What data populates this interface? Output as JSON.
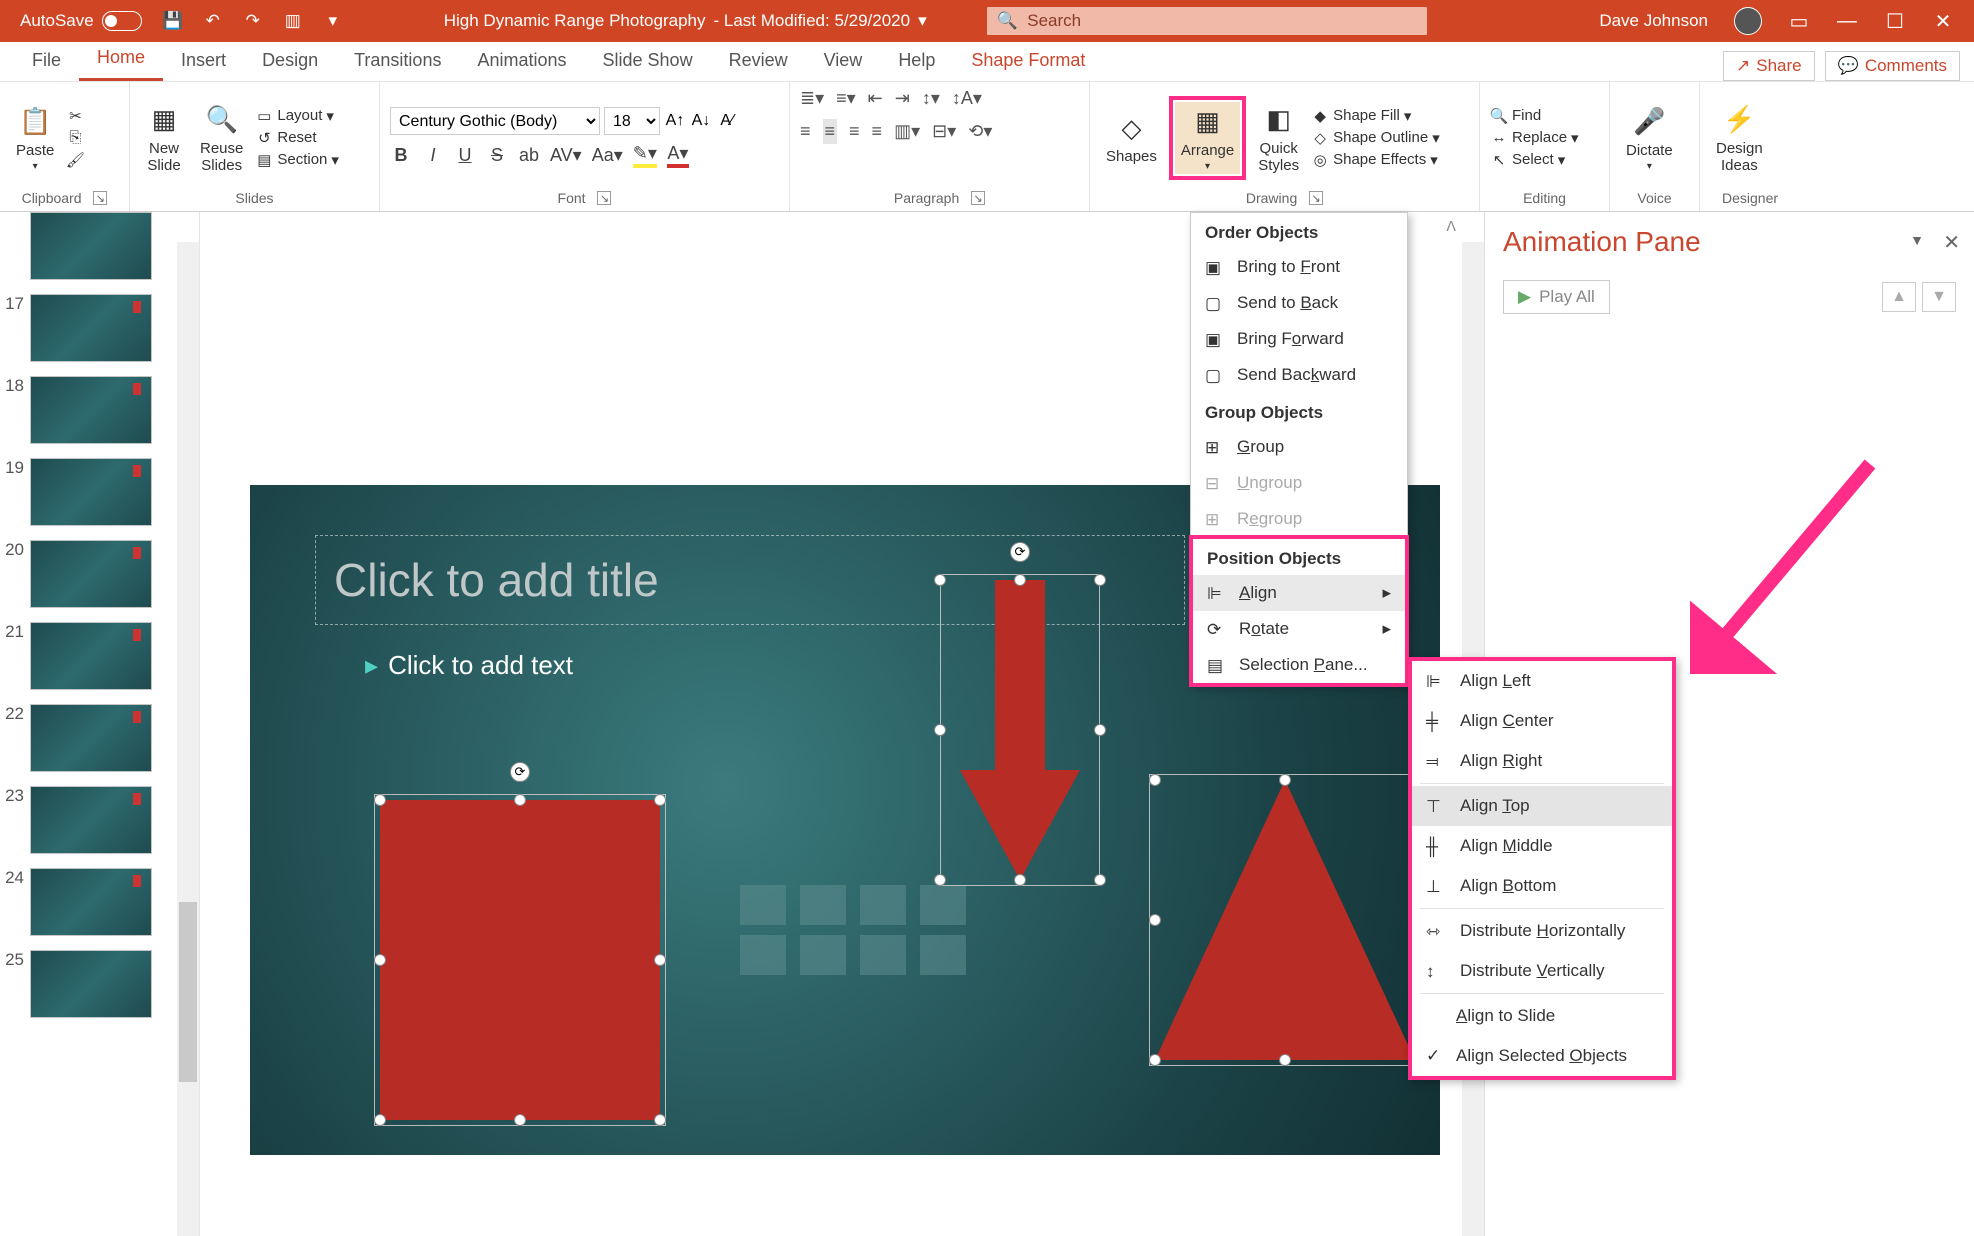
{
  "titlebar": {
    "autosave_label": "AutoSave",
    "doc_title": "High Dynamic Range Photography",
    "last_modified": "- Last Modified: 5/29/2020",
    "search_placeholder": "Search",
    "user_name": "Dave Johnson"
  },
  "tabs": {
    "file": "File",
    "home": "Home",
    "insert": "Insert",
    "design": "Design",
    "transitions": "Transitions",
    "animations": "Animations",
    "slideshow": "Slide Show",
    "review": "Review",
    "view": "View",
    "help": "Help",
    "shape_format": "Shape Format",
    "share": "Share",
    "comments": "Comments"
  },
  "ribbon": {
    "clipboard": {
      "label": "Clipboard",
      "paste": "Paste"
    },
    "slides": {
      "label": "Slides",
      "new_slide": "New\nSlide",
      "reuse_slides": "Reuse\nSlides",
      "layout": "Layout",
      "reset": "Reset",
      "section": "Section"
    },
    "font": {
      "label": "Font",
      "name": "Century Gothic (Body)",
      "size": "18"
    },
    "paragraph": {
      "label": "Paragraph"
    },
    "drawing": {
      "label": "Drawing",
      "shapes": "Shapes",
      "arrange": "Arrange",
      "quick_styles": "Quick\nStyles",
      "shape_fill": "Shape Fill",
      "shape_outline": "Shape Outline",
      "shape_effects": "Shape Effects"
    },
    "editing": {
      "label": "Editing",
      "find": "Find",
      "replace": "Replace",
      "select": "Select"
    },
    "voice": {
      "label": "Voice",
      "dictate": "Dictate"
    },
    "designer": {
      "label": "Designer",
      "design_ideas": "Design\nIdeas"
    }
  },
  "arrange_menu": {
    "order_hdr": "Order Objects",
    "bring_front": "Bring to Front",
    "send_back": "Send to Back",
    "bring_forward": "Bring Forward",
    "send_backward": "Send Backward",
    "group_hdr": "Group Objects",
    "group": "Group",
    "ungroup": "Ungroup",
    "regroup": "Regroup",
    "position_hdr": "Position Objects",
    "align": "Align",
    "rotate": "Rotate",
    "selection_pane": "Selection Pane..."
  },
  "align_menu": {
    "align_left": "Align Left",
    "align_center": "Align Center",
    "align_right": "Align Right",
    "align_top": "Align Top",
    "align_middle": "Align Middle",
    "align_bottom": "Align Bottom",
    "dist_h": "Distribute Horizontally",
    "dist_v": "Distribute Vertically",
    "align_slide": "Align to Slide",
    "align_selected": "Align Selected Objects"
  },
  "slide": {
    "title_placeholder": "Click to add title",
    "body_placeholder": "Click to add text"
  },
  "thumbs": {
    "nums": [
      "17",
      "18",
      "19",
      "20",
      "21",
      "22",
      "23",
      "24",
      "25"
    ]
  },
  "anim_pane": {
    "title": "Animation Pane",
    "play_all": "Play All"
  }
}
